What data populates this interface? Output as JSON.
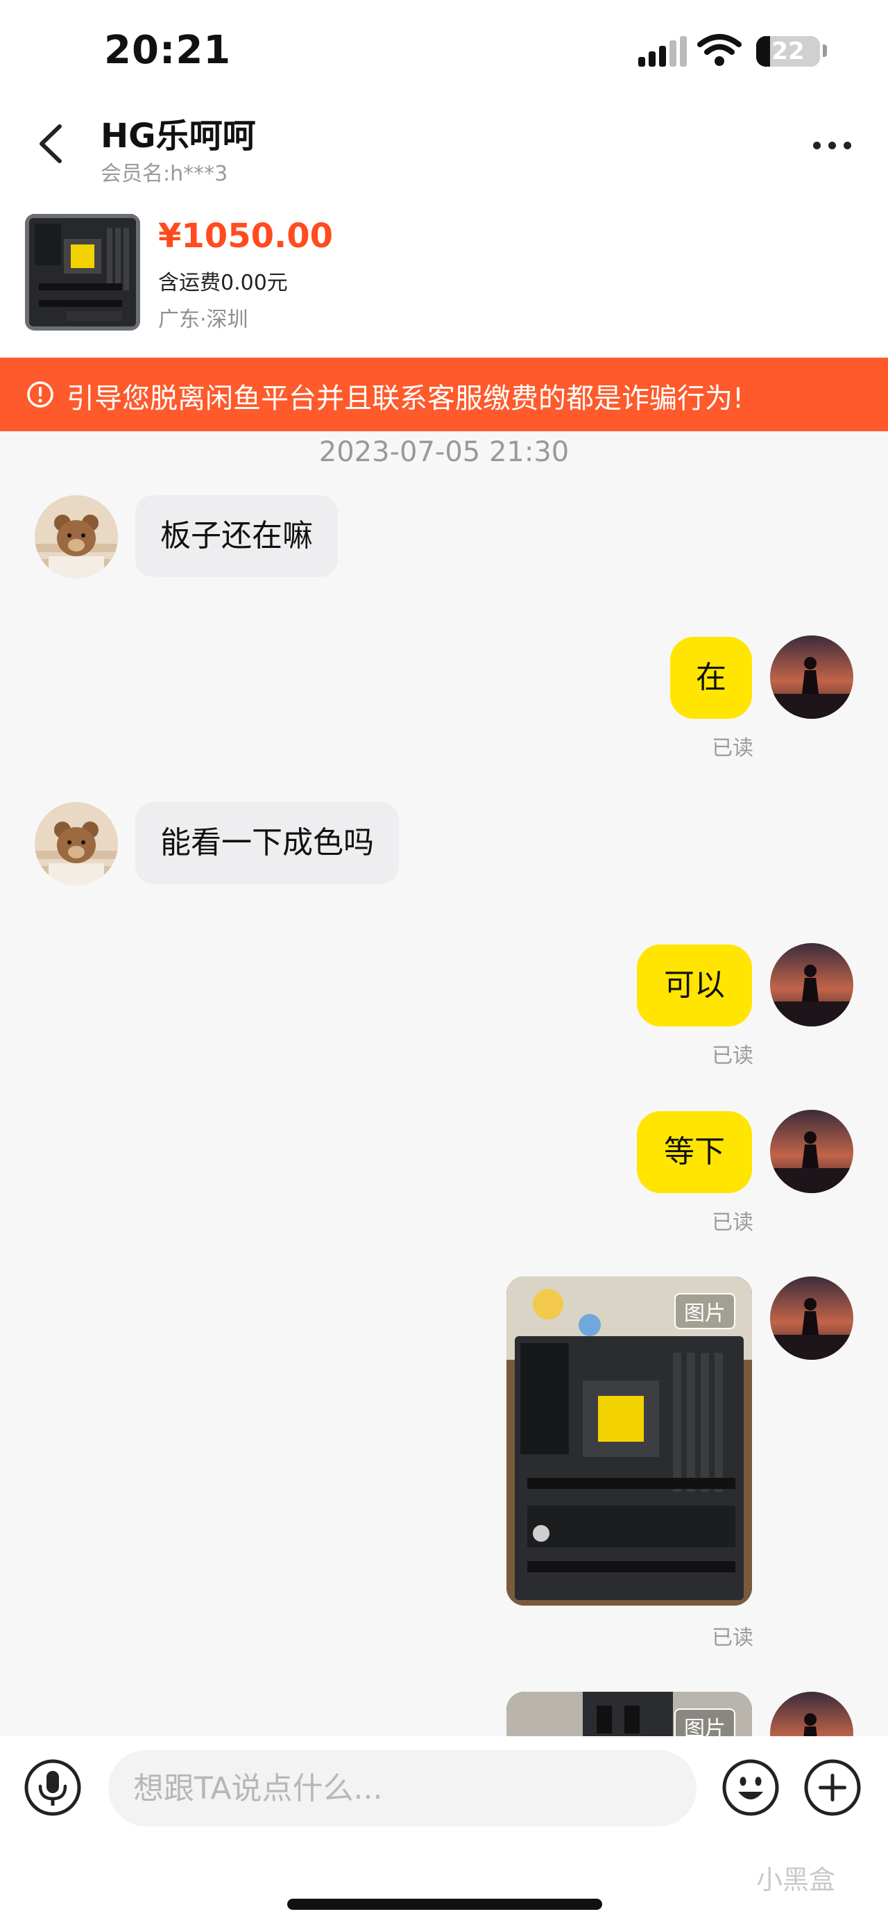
{
  "status_bar": {
    "time": "20:21",
    "battery": "22",
    "battery_fraction": 0.22
  },
  "header": {
    "title": "HG乐呵呵",
    "member_label": "会员名:",
    "member_id": "h***3"
  },
  "product": {
    "price": "¥1050.00",
    "shipping": "含运费0.00元",
    "location": "广东·深圳"
  },
  "warning": {
    "text": "引导您脱离闲鱼平台并且联系客服缴费的都是诈骗行为!"
  },
  "chat": {
    "timestamp": "2023-07-05 21:30",
    "read_label": "已读",
    "image_tag": "图片",
    "messages": [
      {
        "from": "buyer",
        "type": "text",
        "text": "板子还在嘛"
      },
      {
        "from": "seller",
        "type": "text",
        "text": "在",
        "status": "已读"
      },
      {
        "from": "buyer",
        "type": "text",
        "text": "能看一下成色吗"
      },
      {
        "from": "seller",
        "type": "text",
        "text": "可以",
        "status": "已读"
      },
      {
        "from": "seller",
        "type": "text",
        "text": "等下",
        "status": "已读"
      },
      {
        "from": "seller",
        "type": "image",
        "tag": "图片",
        "status": "已读"
      },
      {
        "from": "seller",
        "type": "image",
        "tag": "图片"
      }
    ]
  },
  "input": {
    "placeholder": "想跟TA说点什么..."
  },
  "watermark": "小黑盒",
  "icons": {
    "back": "chevron-left-icon",
    "more": "more-horizontal-icon",
    "warning": "alert-circle-icon",
    "voice": "microphone-icon",
    "emoji": "emoji-icon",
    "add": "plus-circle-icon",
    "wifi": "wifi-icon",
    "signal": "signal-icon",
    "battery": "battery-icon"
  },
  "colors": {
    "accent_price": "#ff4b1f",
    "warning_bg": "#fe5a2b",
    "my_bubble": "#ffe500",
    "their_bubble": "#eeeef0",
    "page_bg": "#f7f7f7"
  }
}
